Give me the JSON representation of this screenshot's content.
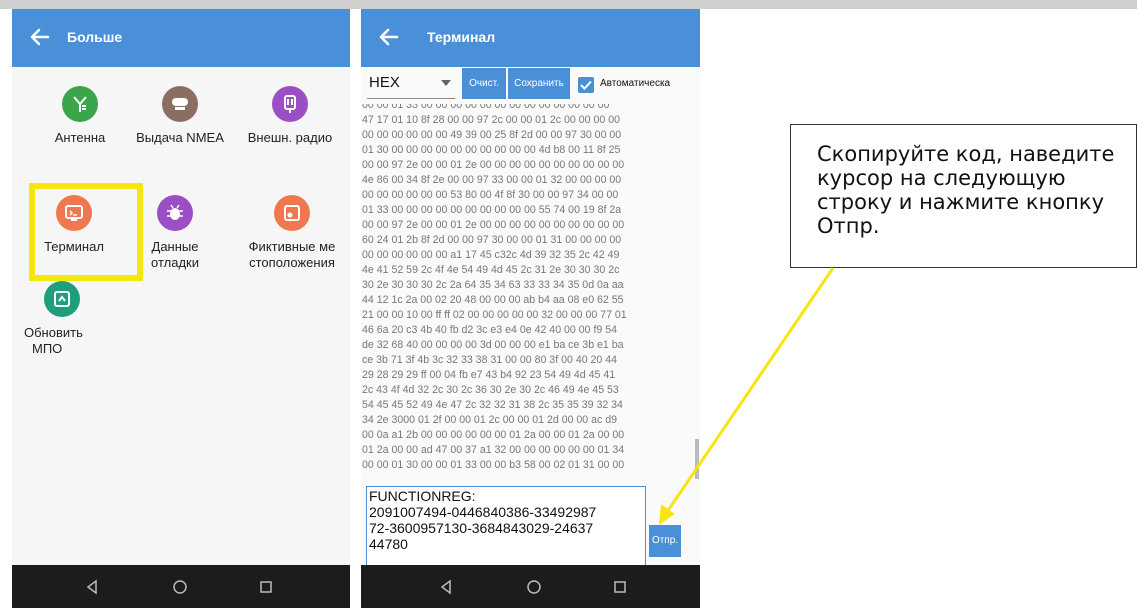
{
  "screen_left": {
    "title": "Больше",
    "tiles": [
      {
        "label": "Антенна",
        "color": "#3aa54a",
        "icon": "antenna-icon"
      },
      {
        "label": "Выдача NMEA",
        "color": "#8b6e62",
        "icon": "nmea-icon"
      },
      {
        "label": "Внешн. радио",
        "color": "#9c4fc4",
        "icon": "radio-icon"
      },
      {
        "label": "Терминал",
        "color": "#f07850",
        "icon": "terminal-icon"
      },
      {
        "label": "Данные отладки",
        "color": "#9c4fc4",
        "icon": "bug-icon"
      },
      {
        "label": "Фиктивные местоположения",
        "color": "#f07850",
        "icon": "location-icon"
      },
      {
        "label": "Обновить МПО",
        "color": "#1e9e7d",
        "icon": "update-icon"
      }
    ],
    "label_lines": {
      "t4": [
        "Данные",
        "отладки"
      ],
      "t5": [
        "Фиктивные ме",
        "стоположения"
      ],
      "t6": [
        "Обновить",
        "МПО"
      ]
    },
    "highlight_color": "#f5e60f"
  },
  "screen_right": {
    "title": "Терминал",
    "format_select": "HEX",
    "clear_button": "Очист.",
    "save_button": "Сохранить",
    "auto_checkbox_label": "Автоматическа",
    "auto_checked": true,
    "hex_lines": [
      "00 00 01 33 00 00 00 00 00 00 00 00 00 00 00 00 00",
      "47 17 01 10 8f 28 00 00 97 2c 00 00 01 2c 00 00 00 00",
      "00 00 00 00 00 00 49 39 00 25 8f 2d 00 00 97 30 00 00",
      "01 30 00 00 00 00 00 00 00 00 00 00 4d b8 00 11 8f 25",
      "00 00 97 2e 00 00 01 2e 00 00 00 00 00 00 00 00 00 00",
      "4e 86 00 34 8f 2e 00 00 97 33 00 00 01 32 00 00 00 00",
      "00 00 00 00 00 00 53 80 00 4f 8f 30 00 00 97 34 00 00",
      "01 33 00 00 00 00 00 00 00 00 00 00 55 74 00 19 8f 2a",
      "00 00 97 2e 00 00 01 2e 00 00 00 00 00 00 00 00 00 00",
      "60 24 01 2b 8f 2d 00 00 97 30 00 00 01 31 00 00 00 00",
      "00 00 00 00 00 00 a1 17 45 c32c 4d 39 32 35 2c 42 49",
      "4e 41 52 59 2c 4f 4e 54 49 4d 45 2c 31 2e 30 30 30 2c",
      "30 2e 30 30 30 2c 2a 64 35 34 63 33 33 34 35 0d 0a aa",
      "44 12 1c 2a 00 02 20 48 00 00 00 ab b4 aa 08 e0 62 55",
      "21 00 00 10 00 ff ff 02 00 00 00 00 00 32 00 00 00 77 01",
      "46 6a 20 c3 4b 40 fb d2 3c e3 e4 0e 42 40 00 00 f9 54",
      "de 32 68 40 00 00 00 00 3d 00 00 00 e1 ba ce 3b e1 ba",
      "ce 3b 71 3f 4b 3c 32 33 38 31 00 00 80 3f 00 40 20 44",
      "29 28 29 29 ff 00 04 fb e7 43 b4 92 23 54 49 4d 45 41",
      "2c 43 4f 4d 32 2c 30 2c 36 30 2e 30 2c 46 49 4e 45 53",
      "54 45 45 52 49 4e 47 2c 32 32 31 38 2c 35 35 39 32 34",
      "34 2e 3000 01 2f 00 00 01 2c 00 00 01 2d 00 00 ac d9",
      "00 0a a1 2b 00 00 00 00 00 00 01 2a 00 00 01 2a 00 00",
      "01 2a 00 00 ad 47 00 37 a1 32 00 00 00 00 00 00 01 34",
      "00 00 01 30 00 00 01 33 00 00 b3 58 00 02 01 31 00 00"
    ],
    "command_lines": [
      "FUNCTIONREG:",
      "2091007494-0446840386-33492987",
      "72-3600957130-3684843029-24637",
      "44780"
    ],
    "send_button": "Отпр."
  },
  "callout_text": "Скопируйте код, наведите курсор на следующую строку и нажмите кнопку Отпр.",
  "colors": {
    "appbar": "#4a90d9",
    "navbar": "#1c1c1c",
    "arrow": "#f5e60f"
  },
  "nav_icons": [
    "back-triangle-icon",
    "home-circle-icon",
    "recents-square-icon"
  ]
}
